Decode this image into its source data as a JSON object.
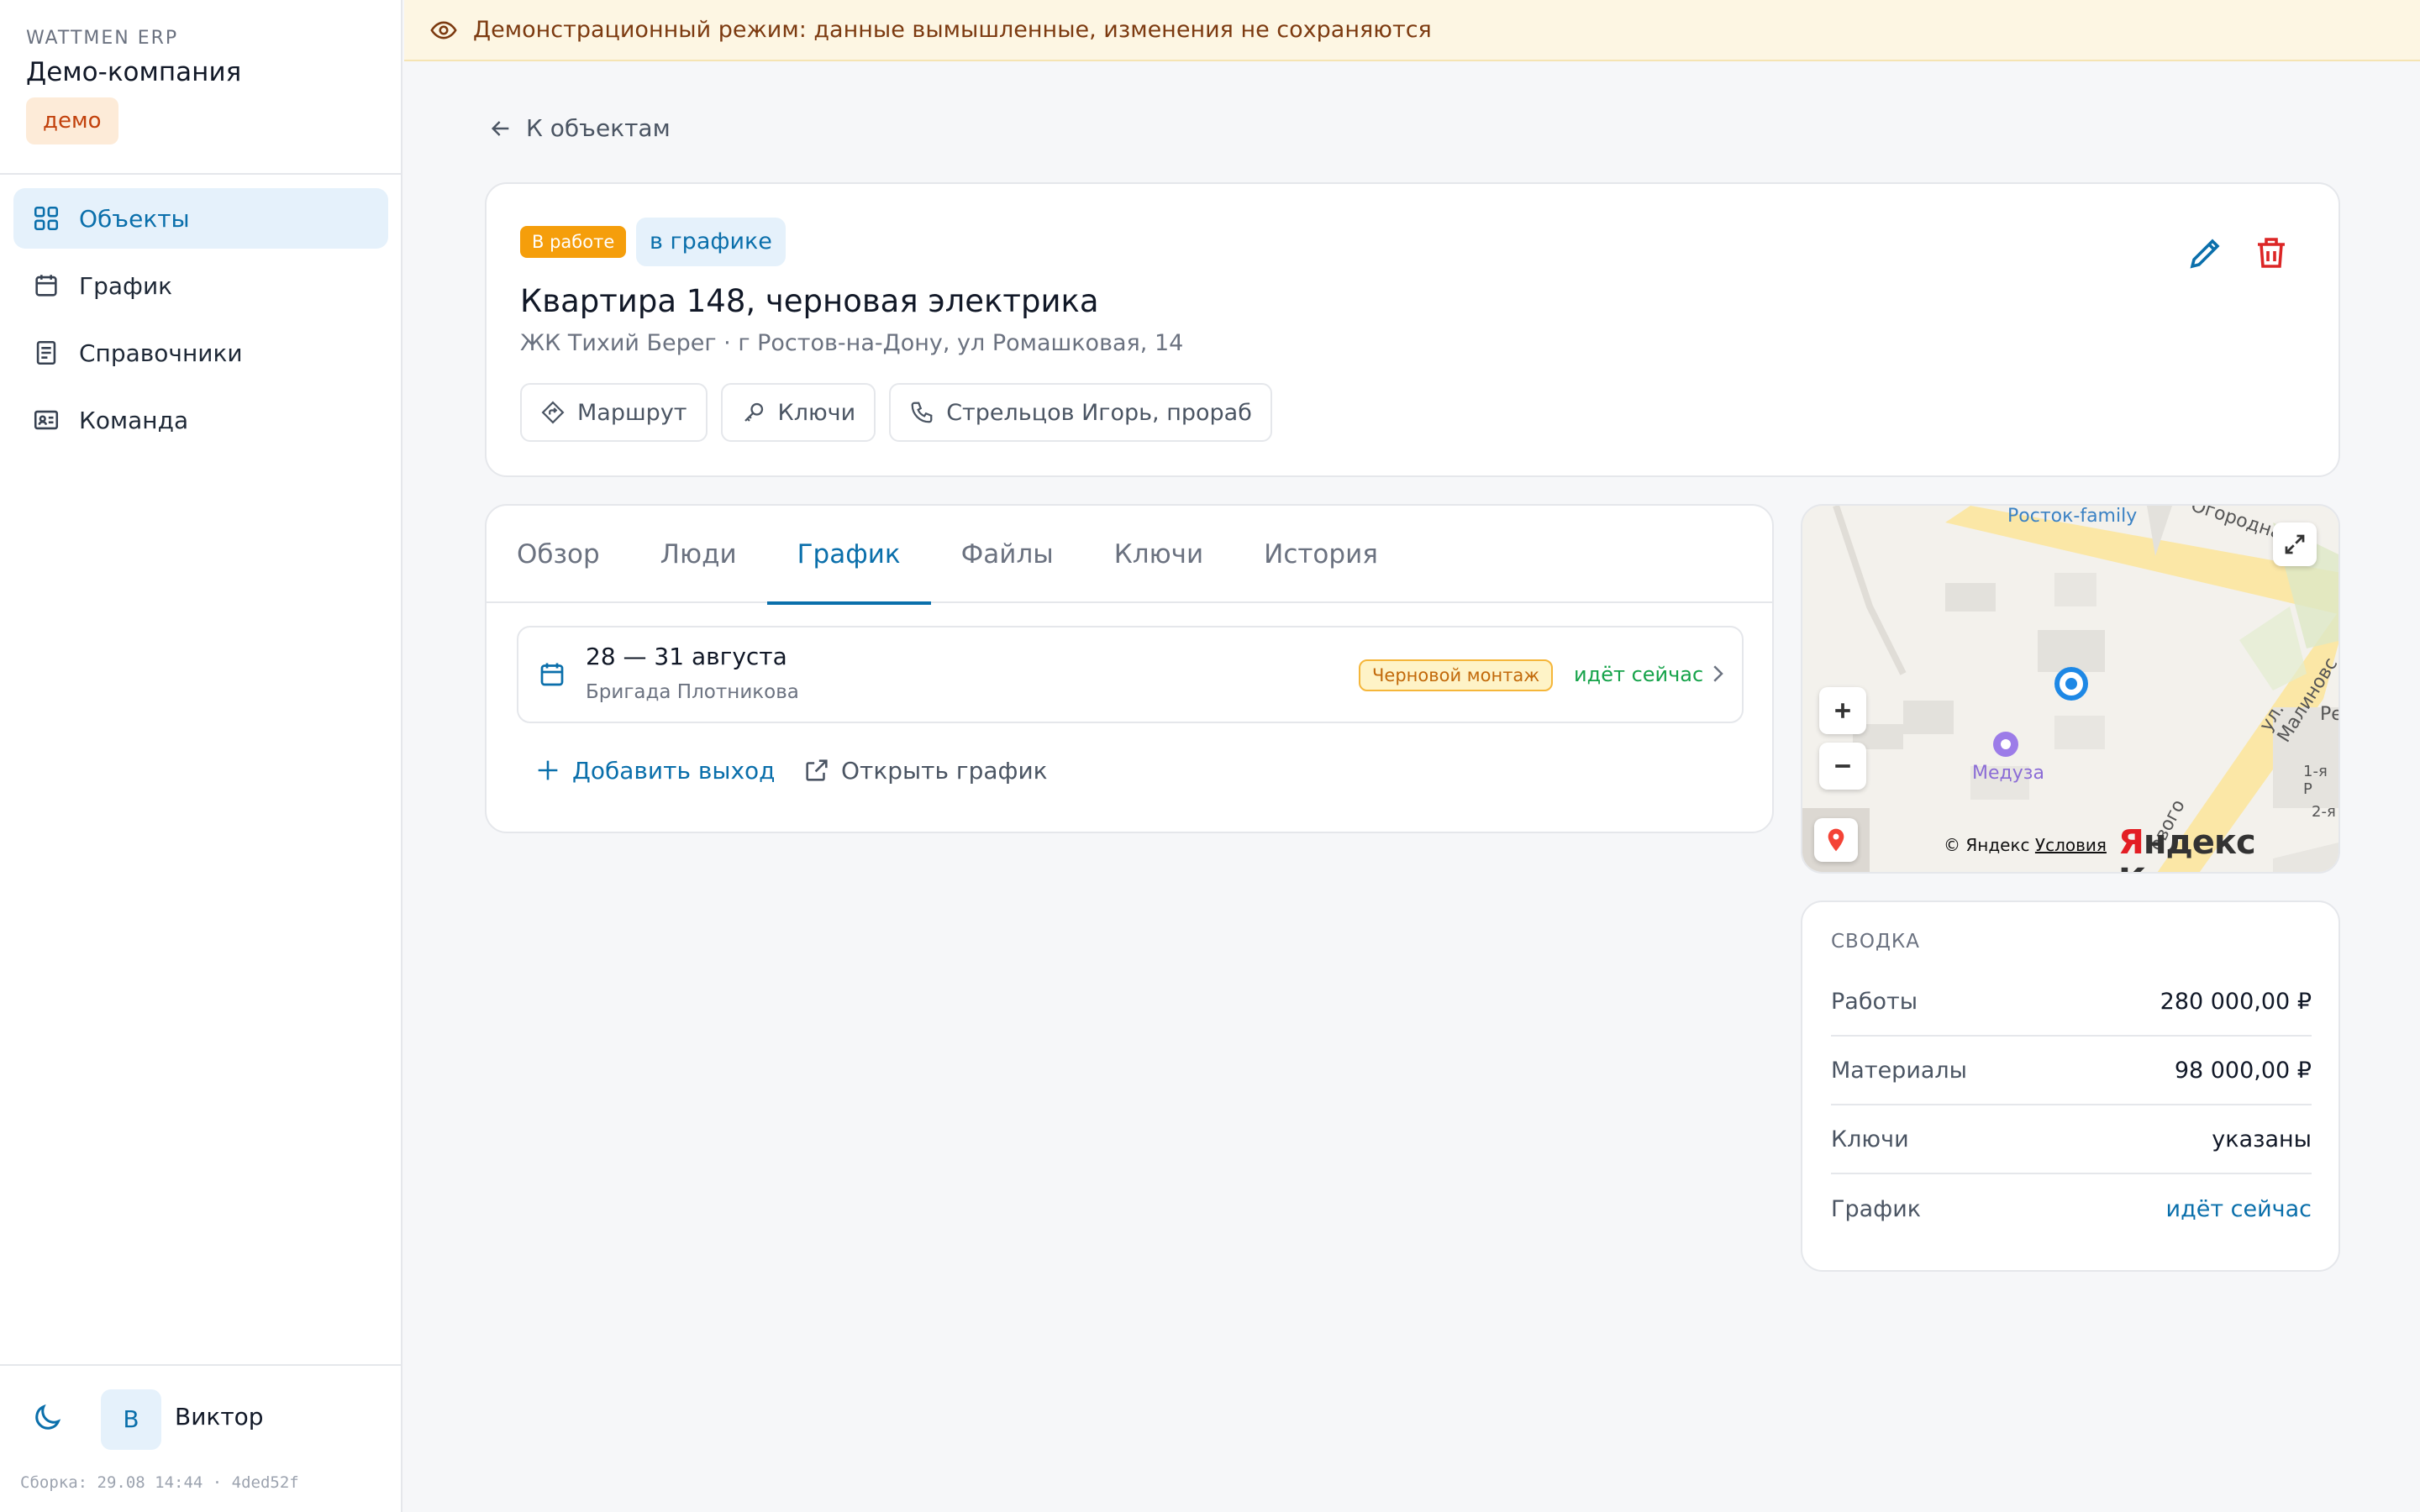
{
  "sidebar": {
    "brand": "WATTMEN ERP",
    "company": "Демо-компания",
    "demo_badge": "демо",
    "nav": [
      {
        "label": "Объекты",
        "icon": "grid-icon",
        "active": true
      },
      {
        "label": "График",
        "icon": "calendar-icon",
        "active": false
      },
      {
        "label": "Справочники",
        "icon": "book-icon",
        "active": false
      },
      {
        "label": "Команда",
        "icon": "id-card-icon",
        "active": false
      }
    ],
    "user": {
      "initial": "В",
      "name": "Виктор"
    },
    "build": "Сборка: 29.08 14:44 · 4ded52f"
  },
  "banner": {
    "text": "Демонстрационный режим: данные вымышленные, изменения не сохраняются"
  },
  "back_link": "К объектам",
  "object": {
    "status": "В работе",
    "schedule_badge": "в графике",
    "title": "Квартира 148, черновая электрика",
    "address": "ЖК Тихий Берег · г Ростов-на-Дону, ул Ромашковая, 14",
    "chips": {
      "route": "Маршрут",
      "keys": "Ключи",
      "contact": "Стрельцов Игорь, прораб"
    }
  },
  "tabs": [
    "Обзор",
    "Люди",
    "График",
    "Файлы",
    "Ключи",
    "История"
  ],
  "active_tab": "График",
  "schedule": {
    "dates": "28 — 31 августа",
    "team": "Бригада Плотникова",
    "stage": "Черновой монтаж",
    "state": "идёт сейчас",
    "add_label": "Добавить выход",
    "open_label": "Открыть график"
  },
  "map": {
    "labels": {
      "poi1": "Росток-family",
      "poi2": "Медуза",
      "street1": "Огородная",
      "street2": "ул. Малиновс",
      "street3": "Ре",
      "street4": "1-я Р",
      "street5": "2-я",
      "street6": "ового"
    },
    "credit_prefix": "© Яндекс",
    "credit_link": "Условия",
    "logo_accent": "Я",
    "logo_rest": "ндекс Карты"
  },
  "summary": {
    "title": "СВОДКА",
    "rows": [
      {
        "label": "Работы",
        "value": "280 000,00 ₽"
      },
      {
        "label": "Материалы",
        "value": "98 000,00 ₽"
      },
      {
        "label": "Ключи",
        "value": "указаны"
      },
      {
        "label": "График",
        "value": "идёт сейчас"
      }
    ]
  },
  "colors": {
    "accent": "#0a6fab",
    "status_orange": "#f59e0b",
    "success": "#16a34a",
    "danger": "#dc2626"
  }
}
